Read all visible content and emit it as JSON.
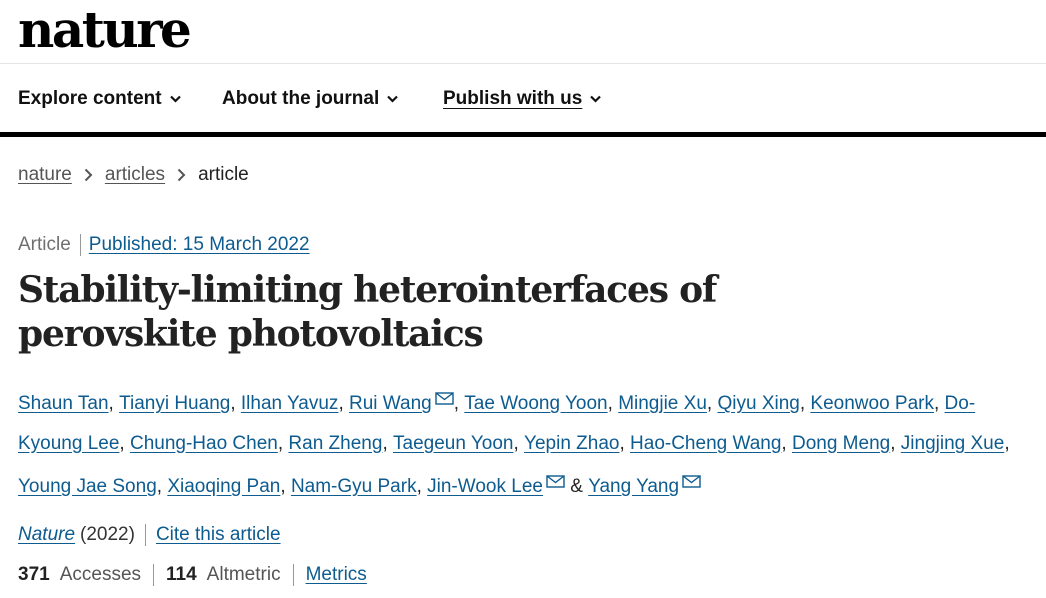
{
  "brand": {
    "logo": "nature"
  },
  "nav": {
    "items": [
      {
        "label": "Explore content"
      },
      {
        "label": "About the journal"
      },
      {
        "label": "Publish with us"
      }
    ]
  },
  "breadcrumb": {
    "items": [
      "nature",
      "articles",
      "article"
    ]
  },
  "article": {
    "type": "Article",
    "published": "Published: 15 March 2022",
    "title": "Stability-limiting heterointerfaces of perovskite photovoltaics",
    "authors": [
      {
        "name": "Shaun Tan",
        "corresponding": false
      },
      {
        "name": "Tianyi Huang",
        "corresponding": false
      },
      {
        "name": "Ilhan Yavuz",
        "corresponding": false
      },
      {
        "name": "Rui Wang",
        "corresponding": true
      },
      {
        "name": "Tae Woong Yoon",
        "corresponding": false
      },
      {
        "name": "Mingjie Xu",
        "corresponding": false
      },
      {
        "name": "Qiyu Xing",
        "corresponding": false
      },
      {
        "name": "Keonwoo Park",
        "corresponding": false
      },
      {
        "name": "Do-Kyoung Lee",
        "corresponding": false
      },
      {
        "name": "Chung-Hao Chen",
        "corresponding": false
      },
      {
        "name": "Ran Zheng",
        "corresponding": false
      },
      {
        "name": "Taegeun Yoon",
        "corresponding": false
      },
      {
        "name": "Yepin Zhao",
        "corresponding": false
      },
      {
        "name": "Hao-Cheng Wang",
        "corresponding": false
      },
      {
        "name": "Dong Meng",
        "corresponding": false
      },
      {
        "name": "Jingjing Xue",
        "corresponding": false
      },
      {
        "name": "Young Jae Song",
        "corresponding": false
      },
      {
        "name": "Xiaoqing Pan",
        "corresponding": false
      },
      {
        "name": "Nam-Gyu Park",
        "corresponding": false
      },
      {
        "name": "Jin-Wook Lee",
        "corresponding": true
      },
      {
        "name": "Yang Yang",
        "corresponding": true
      }
    ],
    "journal": "Nature",
    "year": "(2022)",
    "cite_label": "Cite this article",
    "accesses_value": "371",
    "accesses_label": "Accesses",
    "altmetric_value": "114",
    "altmetric_label": "Altmetric",
    "metrics_label": "Metrics"
  },
  "colors": {
    "link": "#0d5b8f",
    "text": "#222222",
    "muted": "#6f6f6f",
    "rule": "#000000"
  }
}
